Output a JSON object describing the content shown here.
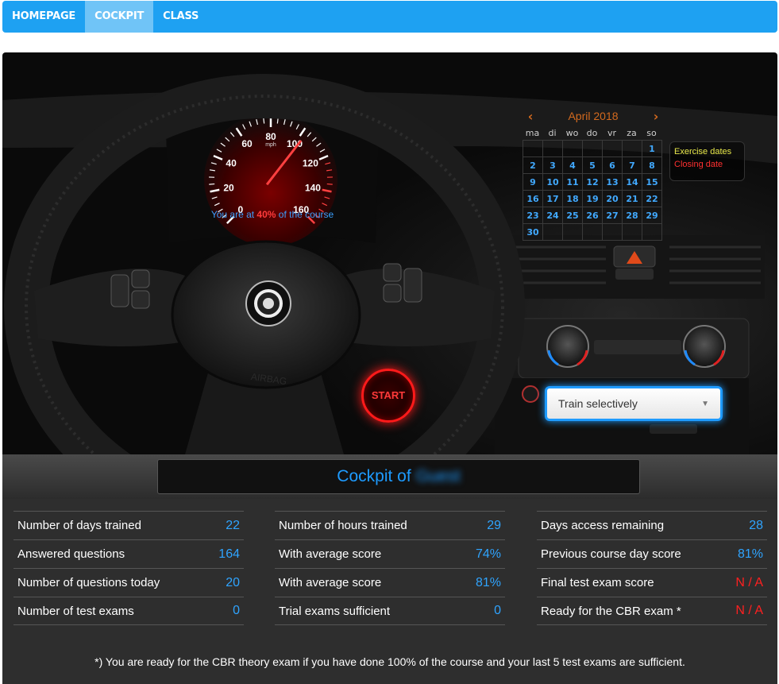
{
  "nav": {
    "items": [
      {
        "label": "HOMEPAGE",
        "active": false
      },
      {
        "label": "COCKPIT",
        "active": true
      },
      {
        "label": "CLASS",
        "active": false
      }
    ]
  },
  "speedometer": {
    "ticks": [
      "0",
      "20",
      "40",
      "60",
      "80",
      "100",
      "120",
      "140",
      "160"
    ],
    "unit": "mph",
    "course_text_prefix": "You are at ",
    "course_percent": "40%",
    "course_text_suffix": " of the course",
    "progress": 0.4
  },
  "calendar": {
    "month": "April 2018",
    "prev_icon": "chevron-left-icon",
    "next_icon": "chevron-right-icon",
    "weekdays": [
      "ma",
      "di",
      "wo",
      "do",
      "vr",
      "za",
      "so"
    ],
    "first_weekday_index": 6,
    "days": [
      "1",
      "2",
      "3",
      "4",
      "5",
      "6",
      "7",
      "8",
      "9",
      "10",
      "11",
      "12",
      "13",
      "14",
      "15",
      "16",
      "17",
      "18",
      "19",
      "20",
      "21",
      "22",
      "23",
      "24",
      "25",
      "26",
      "27",
      "28",
      "29",
      "30"
    ]
  },
  "legend": {
    "exercise": "Exercise dates",
    "closing": "Closing date",
    "exercise_color": "#e8e84a",
    "closing_color": "#ff3030"
  },
  "start_button": {
    "label": "START"
  },
  "train_select": {
    "value": "Train selectively"
  },
  "title": {
    "prefix": "Cockpit of",
    "user": "Guest"
  },
  "stats": {
    "col1": [
      {
        "label": "Number of days trained",
        "value": "22"
      },
      {
        "label": "Answered questions",
        "value": "164"
      },
      {
        "label": "Number of questions today",
        "value": "20"
      },
      {
        "label": "Number of test exams",
        "value": "0"
      }
    ],
    "col2": [
      {
        "label": "Number of hours trained",
        "value": "29"
      },
      {
        "label": "With average score",
        "value": "74%"
      },
      {
        "label": "With average score",
        "value": "81%"
      },
      {
        "label": "Trial exams sufficient",
        "value": "0"
      }
    ],
    "col3": [
      {
        "label": "Days access remaining",
        "value": "28"
      },
      {
        "label": "Previous course day score",
        "value": "81%"
      },
      {
        "label": "Final test exam score",
        "value": "N / A"
      },
      {
        "label": "Ready for the CBR exam *",
        "value": "N / A"
      }
    ]
  },
  "footnote": "*) You are ready for the CBR theory exam if you have done 100% of the course and your last 5 test exams are sufficient.",
  "colors": {
    "accent": "#1ea1f2",
    "value_blue": "#2fa4ff",
    "alert_red": "#ff2020"
  }
}
